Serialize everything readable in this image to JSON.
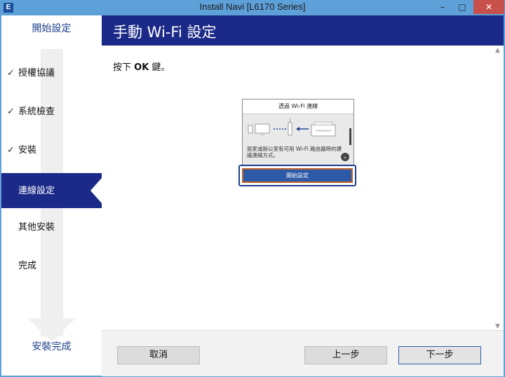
{
  "window": {
    "title": "Install Navi [L6170 Series]",
    "app_icon": "E"
  },
  "sidebar": {
    "top_label": "開始設定",
    "steps": [
      {
        "label": "授權協議",
        "done": true
      },
      {
        "label": "系統檢查",
        "done": true
      },
      {
        "label": "安裝",
        "done": true
      },
      {
        "label": "連線設定",
        "active": true
      },
      {
        "label": "其他安裝"
      },
      {
        "label": "完成"
      }
    ],
    "bottom_label": "安裝完成"
  },
  "main": {
    "title": "手動 Wi-Fi 設定",
    "instruction_prefix": "按下 ",
    "instruction_key": "OK",
    "instruction_suffix": " 鍵。",
    "device": {
      "header": "透過 Wi-Fi 連線",
      "description": "居家或辦公室有可用 Wi-Fi 路由器時的建議連線方式。",
      "button": "開始設定"
    }
  },
  "footer": {
    "cancel": "取消",
    "back": "上一步",
    "next": "下一步"
  },
  "colors": {
    "accent": "#1b2a88",
    "titlebar": "#5ea0d8",
    "close": "#c7514a"
  }
}
